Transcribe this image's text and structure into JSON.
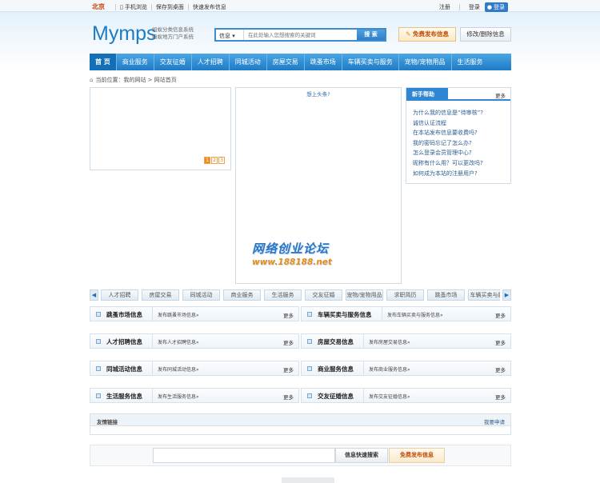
{
  "topbar": {
    "city": "北京",
    "links": [
      "手机浏览",
      "保存到桌面",
      "快速发布信息"
    ],
    "login": "注册",
    "register": "登录",
    "qq_login": "登录"
  },
  "header": {
    "logo": "Mymps",
    "slogan_1": "蚂蚁分类信息系统",
    "slogan_2": "蚂蚁地方门户系统",
    "search": {
      "category": "信息 ▾",
      "placeholder": "在此处输入您想搜索的关键词",
      "button": "搜 索"
    },
    "post_button": "免费发布信息",
    "edit_button": "修改/删除信息"
  },
  "nav": [
    "首 页",
    "商业服务",
    "交友征婚",
    "人才招聘",
    "同城活动",
    "房屋交易",
    "跳蚤市场",
    "车辆买卖与服务",
    "宠物/宠物用品",
    "生活服务"
  ],
  "breadcrumb": "当前位置：我的网站 > 网站首页",
  "focus": {
    "pages": [
      "1",
      "2",
      "3"
    ]
  },
  "center": {
    "title": "想上头条?",
    "watermark_1": "网络创业论坛",
    "watermark_2": "www.188188.net"
  },
  "help": {
    "title": "新手帮助",
    "more": "更多",
    "items": [
      "为什么我的信息是“待审核”?",
      "诚信认证流程",
      "在本站发布信息要收费吗?",
      "我的密码忘记了怎么办?",
      "怎么登录会员管理中心?",
      "昵称有什么用？可以更改吗?",
      "如何成为本站的注册用户?"
    ]
  },
  "strip": {
    "left": "◀",
    "right": "▶",
    "tabs": [
      "人才招聘",
      "房屋交易",
      "同城活动",
      "商业服务",
      "生活服务",
      "交友征婚",
      "宠物/宠物用品",
      "求职简历",
      "跳蚤市场",
      "车辆买卖与服"
    ]
  },
  "categories": [
    {
      "name": "跳蚤市场信息",
      "desc": "发布跳蚤市场信息»",
      "more": "更多"
    },
    {
      "name": "车辆买卖与服务信息",
      "desc": "发布车辆买卖与服务信息»",
      "more": "更多"
    },
    {
      "name": "人才招聘信息",
      "desc": "发布人才招聘信息»",
      "more": "更多"
    },
    {
      "name": "房屋交易信息",
      "desc": "发布房屋交易信息»",
      "more": "更多"
    },
    {
      "name": "同城活动信息",
      "desc": "发布同城活动信息»",
      "more": "更多"
    },
    {
      "name": "商业服务信息",
      "desc": "发布商业服务信息»",
      "more": "更多"
    },
    {
      "name": "生活服务信息",
      "desc": "发布生活服务信息»",
      "more": "更多"
    },
    {
      "name": "交友征婚信息",
      "desc": "发布交友征婚信息»",
      "more": "更多"
    }
  ],
  "friends": {
    "title": "友情链接",
    "apply": "我要申请"
  },
  "bottom": {
    "quick_search": "信息快速搜索",
    "post": "免费发布信息"
  }
}
